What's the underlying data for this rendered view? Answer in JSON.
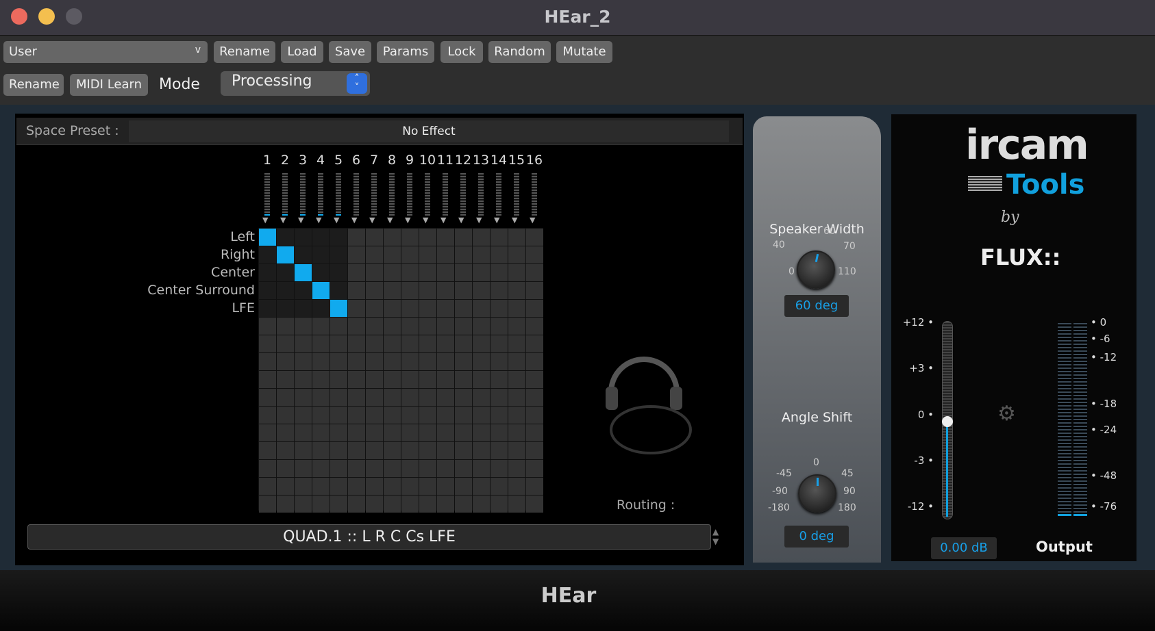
{
  "window": {
    "title": "HEar_2"
  },
  "toolbar": {
    "preset": "User",
    "preset_arrow": "v",
    "buttons": [
      "Rename",
      "Load",
      "Save",
      "Params",
      "Lock",
      "Random",
      "Mutate"
    ],
    "rename2": "Rename",
    "midi_learn": "MIDI Learn",
    "mode_label": "Mode",
    "mode_value": "Processing"
  },
  "plugin": {
    "space_preset_label": "Space Preset :",
    "space_preset_value": "No Effect",
    "columns": [
      "1",
      "2",
      "3",
      "4",
      "5",
      "6",
      "7",
      "8",
      "9",
      "10",
      "11",
      "12",
      "13",
      "14",
      "15",
      "16"
    ],
    "rows": [
      "Left",
      "Right",
      "Center",
      "Center Surround",
      "LFE"
    ],
    "routing_active": [
      [
        0,
        0
      ],
      [
        1,
        1
      ],
      [
        2,
        2
      ],
      [
        3,
        3
      ],
      [
        4,
        4
      ]
    ],
    "routing_label": "Routing :",
    "routing_value": "QUAD.1 :: L R C Cs LFE",
    "speaker_width": {
      "label": "Speaker Width",
      "ticks": [
        "0",
        "40",
        "60",
        "70",
        "110"
      ],
      "value": "60 deg"
    },
    "angle_shift": {
      "label": "Angle Shift",
      "ticks": [
        "-180",
        "-90",
        "-45",
        "0",
        "45",
        "90",
        "180"
      ],
      "value": "0 deg"
    },
    "logo": {
      "ircam": "ircam",
      "tools": "Tools",
      "by": "by",
      "flux": "FLUX::"
    },
    "gain_ticks": [
      "+12",
      "+3",
      "0",
      "-3",
      "-12"
    ],
    "gain_value": "0.00 dB",
    "meter_ticks": [
      "0",
      "-6",
      "-12",
      "-18",
      "-24",
      "-48",
      "-76"
    ],
    "output_label": "Output",
    "footer": "HEar",
    "accent": "#11aaee"
  }
}
